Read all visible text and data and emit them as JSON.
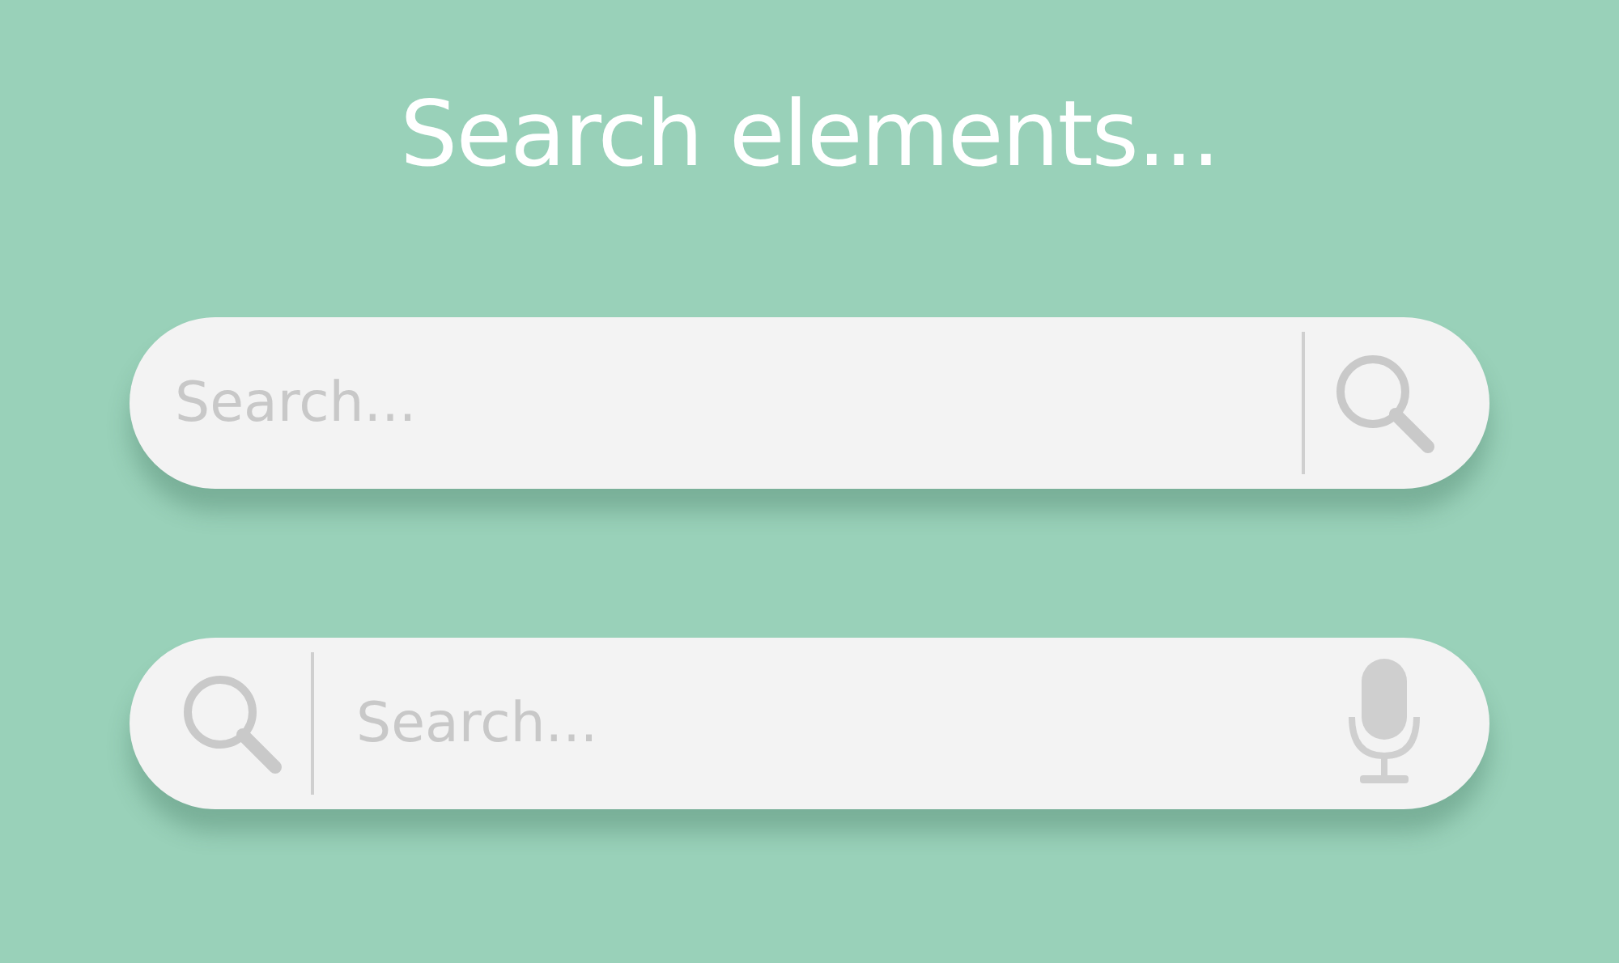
{
  "title": "Search elements...",
  "search_bars": [
    {
      "kind": "icon-right",
      "placeholder": "Search..."
    },
    {
      "kind": "icon-left-mic",
      "placeholder": "Search..."
    }
  ]
}
